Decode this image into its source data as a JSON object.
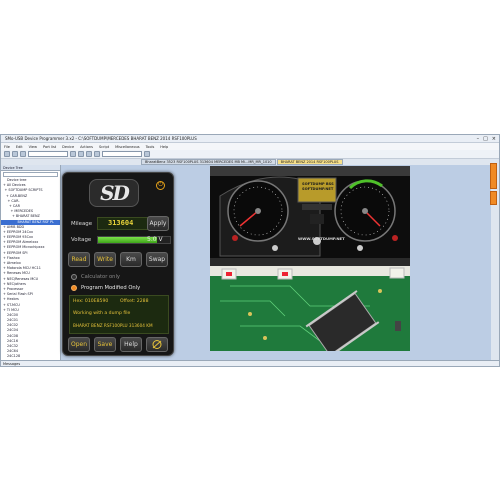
{
  "window": {
    "title": "SMo-USB Device Programmer 3.x2 - C:\\SOFTDUMP\\MERCEDES BHARAT BENZ 2014 RSF100PLUS"
  },
  "menu": [
    "File",
    "Edit",
    "View",
    "Port list",
    "Device",
    "Actions",
    "Script",
    "Miscellaneous",
    "Tools",
    "Help"
  ],
  "tabs": [
    "BharatBenz 3523 RSF100PLUS 313604 MERCEDES MB Mi...MR_MR_1010",
    "BHARAT BENZ 2014 RSF100PLUS"
  ],
  "tree": {
    "header": "Device Tree",
    "items": [
      "Device tree",
      "+ All Devices",
      "+ SOFTDUMP SCRIPTS",
      "+ CAR-BENZ",
      "+ CAR-",
      "+ CAR",
      "+ MERCEDES",
      "+ BHARAT BENZ",
      "BHARAT BENZ RSF PL",
      "+ AMIB BDD",
      "+ EEPROM 24Cxx",
      "+ EEPROM 93Cxx",
      "+ EEPROM Atmelxxx",
      "+ EEPROM Microchipxxx",
      "+ EEPROM SPI",
      "+ Flashxx",
      "+ Atmelxx",
      "+ Motorola MCU HC11",
      "+ Renesas MCU",
      "+ NEC/Renesas MCU",
      "+ NEC/others",
      "+ Processor",
      "+ Serial Flash SPI",
      "+ Hexbrs",
      "+ ST-MCU",
      "+ TI MCU",
      "24C00",
      "24C01",
      "24C02",
      "24C04",
      "24C08",
      "24C16",
      "24C32",
      "24C64",
      "24C128",
      "24C256",
      "24C512",
      "24C1024",
      "24C02"
    ]
  },
  "status": {
    "text": "Messages"
  },
  "sd": {
    "logo": "SD",
    "mileage_label": "Mileage",
    "mileage_value": "313604",
    "apply_label": "Apply",
    "voltage_label": "Voltage",
    "voltage_value": "5.0 V",
    "voltage_fill": 0.82,
    "read_label": "Read",
    "write_label": "Write",
    "km_label": "Km",
    "swap_label": "Swap",
    "calc_only_label": "Calculator only",
    "prog_modified_label": "Program Modified Only",
    "hex_label": "Hex: 010E8590",
    "offset_label": "Offset: 2288",
    "working_label": "Working with a dump file",
    "file_label": "BHARAT BENZ RSF100PLU 313604 KM",
    "open_label": "Open",
    "save_label": "Save",
    "help_label": "Help"
  },
  "photo": {
    "lcd_line1": "SOFTDUMP BSS",
    "lcd_line2": "SOFTDUMP.NET",
    "watermark": "WWW.SOFTDUMP.NET"
  },
  "colors": {
    "accent_orange": "#f08a24",
    "lcd_yellow": "#e6c23a",
    "lcd_green": "#1c2a10",
    "volt_green": "#4fc02a"
  }
}
